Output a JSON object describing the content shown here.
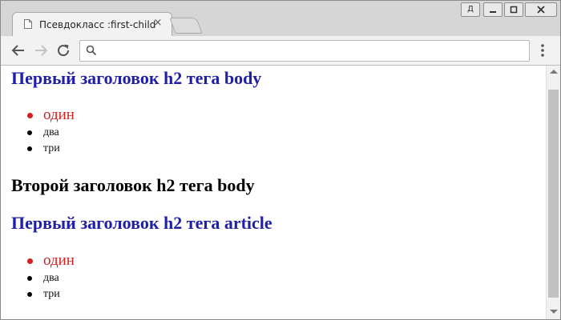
{
  "browser": {
    "tab_title": "Псевдокласс :first-child",
    "tab_close_glyph": "×",
    "user_button_label": "Д",
    "address": {
      "value": "",
      "placeholder": ""
    }
  },
  "page": {
    "heading1": "Первый заголовок h2 тега body",
    "list1": [
      "один",
      "два",
      "три"
    ],
    "heading2": "Второй заголовок h2 тега body",
    "heading3": "Первый заголовок h2 тега article",
    "list2": [
      "один",
      "два",
      "три"
    ]
  },
  "colors": {
    "first_child_heading": "#1f1fa8",
    "first_child_item": "#d42020"
  }
}
